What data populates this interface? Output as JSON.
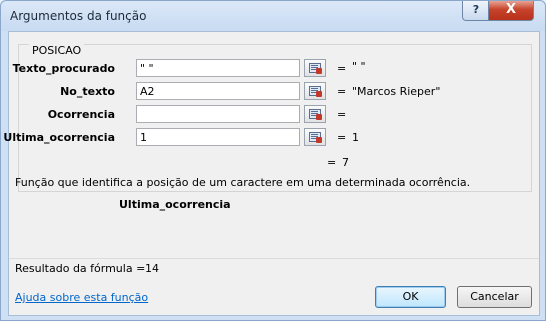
{
  "window": {
    "title": "Argumentos da função",
    "help_label": "?",
    "close_label": "X"
  },
  "function_name": "POSICAO",
  "arguments": [
    {
      "label": "Texto_procurado",
      "value": "\" \"",
      "result": "\" \""
    },
    {
      "label": "No_texto",
      "value": "A2",
      "result": "\"Marcos Rieper\""
    },
    {
      "label": "Ocorrencia",
      "value": "",
      "result": ""
    },
    {
      "label": "Ultima_ocorrencia",
      "value": "1",
      "result": "1"
    }
  ],
  "equals_sign": "=",
  "function_result": "7",
  "description": "Função que identifica a posição de um caractere em uma determinada ocorrência.",
  "current_arg_name": "Ultima_ocorrencia",
  "formula_result_label": "Resultado da fórmula =",
  "formula_result_value": "14",
  "help_link": "Ajuda sobre esta função",
  "buttons": {
    "ok": "OK",
    "cancel": "Cancelar"
  }
}
